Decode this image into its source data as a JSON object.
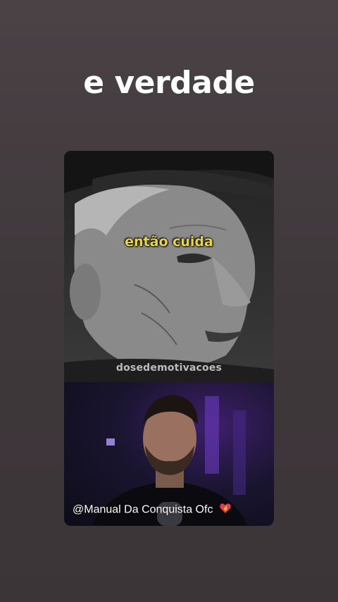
{
  "headline": "e verdade",
  "video_top": {
    "caption": "então cuida",
    "watermark": "dosedemotivacoes"
  },
  "video_bottom": {
    "handle": "@Manual Da Conquista Ofc"
  },
  "icons": {
    "heart": "burning-heart-icon"
  },
  "colors": {
    "background": "#433b3e",
    "caption": "#e8d44a",
    "accent_purple": "#6a3bbf"
  }
}
